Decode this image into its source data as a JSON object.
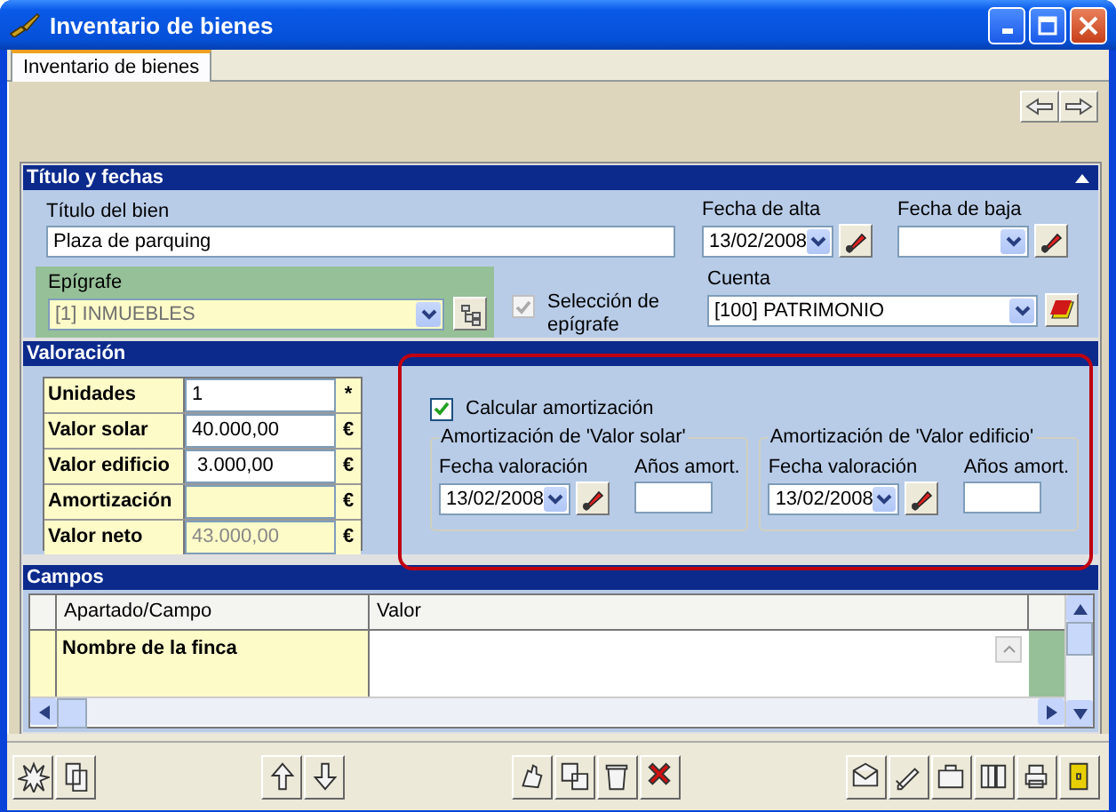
{
  "window": {
    "title": "Inventario de bienes"
  },
  "tabs": [
    {
      "label": "Inventario de bienes",
      "selected": true
    }
  ],
  "titulo_fechas": {
    "header": "Título y fechas",
    "titulo": {
      "label": "Título del bien",
      "value": "Plaza de parquing"
    },
    "fecha_alta": {
      "label": "Fecha de alta",
      "value": "13/02/2008"
    },
    "fecha_baja": {
      "label": "Fecha de baja"
    },
    "epigrafe": {
      "label": "Epígrafe",
      "value": "[1] INMUEBLES",
      "disabled": true
    },
    "seleccion_epigrafe": {
      "label": "Selección de epígrafe",
      "checked": true,
      "disabled": true
    },
    "cuenta": {
      "label": "Cuenta",
      "value": "[100] PATRIMONIO"
    }
  },
  "valoracion": {
    "header": "Valoración",
    "rows": [
      {
        "label": "Unidades",
        "value": "1",
        "unit": "*",
        "disabled": false
      },
      {
        "label": "Valor solar",
        "value": "40.000,00",
        "unit": "€",
        "disabled": false
      },
      {
        "label": "Valor edificio",
        "value": " 3.000,00",
        "unit": "€",
        "disabled": false
      },
      {
        "label": "Amortización",
        "unit": "€",
        "disabled": true
      },
      {
        "label": "Valor neto",
        "value": "43.000,00",
        "unit": "€",
        "disabled": true
      }
    ],
    "calcular": {
      "label": "Calcular amortización",
      "checked": true
    },
    "groups": [
      {
        "title": "Amortización de 'Valor solar'",
        "date_label": "Fecha valoración",
        "date": "13/02/2008",
        "years_label": "Años amort."
      },
      {
        "title": "Amortización de 'Valor edificio'",
        "date_label": "Fecha valoración",
        "date": "13/02/2008",
        "years_label": "Años amort."
      }
    ]
  },
  "campos": {
    "header": "Campos",
    "columns": [
      "Apartado/Campo",
      "Valor"
    ],
    "rows": [
      {
        "campo": "Nombre de la finca"
      }
    ]
  }
}
